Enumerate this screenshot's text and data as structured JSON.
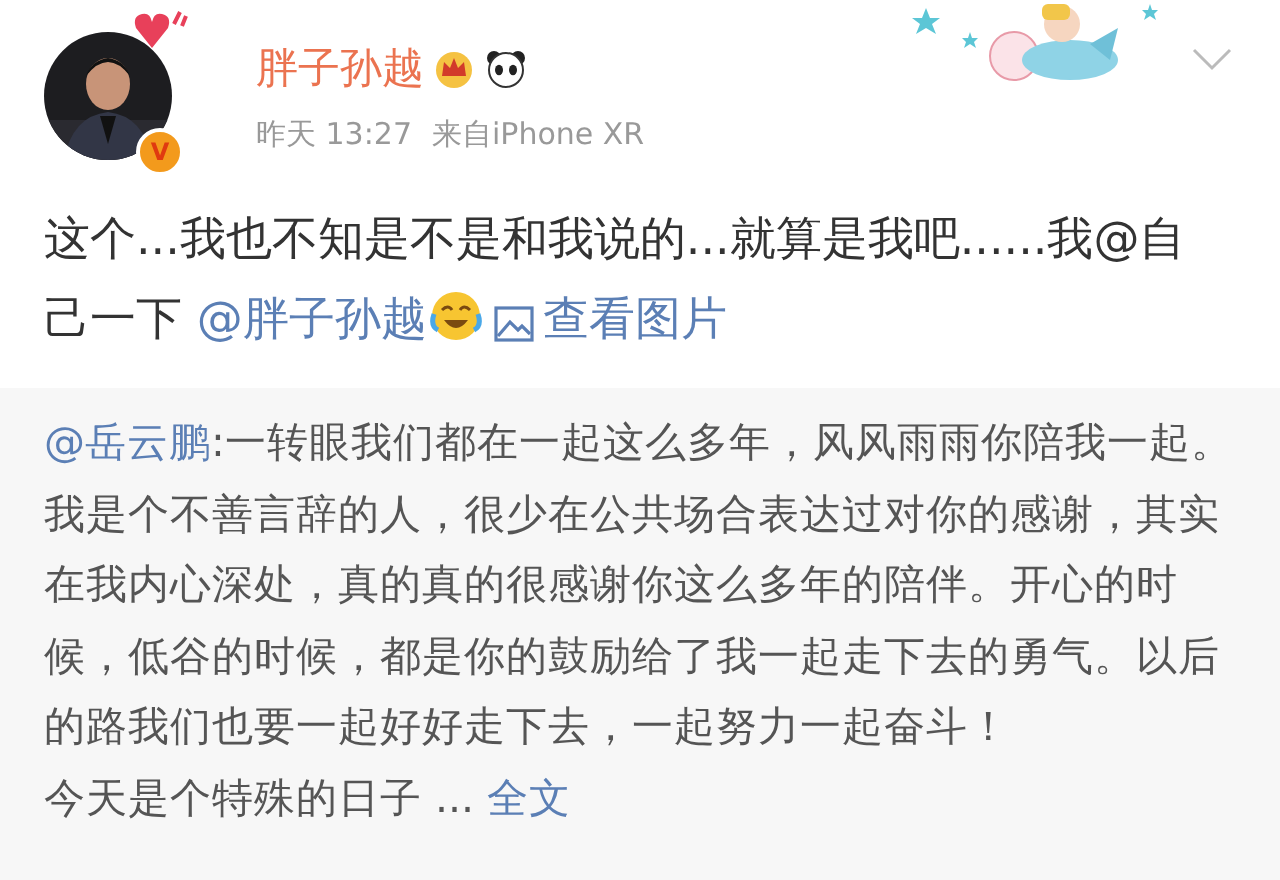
{
  "post": {
    "author": "胖子孙越",
    "verified_badge": "V",
    "time": "昨天 13:27",
    "source": "来自iPhone XR",
    "text": "这个...我也不知是不是和我说的...就算是我吧......我@自己一下",
    "mention": "@胖子孙越",
    "image_link": "查看图片"
  },
  "repost": {
    "mention": "@岳云鹏",
    "body": ":一转眼我们都在一起这么多年，风风雨雨你陪我一起。我是个不善言辞的人，很少在公共场合表达过对你的感谢，其实在我内心深处，真的真的很感谢你这么多年的陪伴。开心的时候，低谷的时候，都是你的鼓励给了我一起走下去的勇气。以后的路我们也要一起好好走下去，一起努力一起奋斗！",
    "tail": "今天是个特殊的日子 ... ",
    "more_link": "全文"
  }
}
